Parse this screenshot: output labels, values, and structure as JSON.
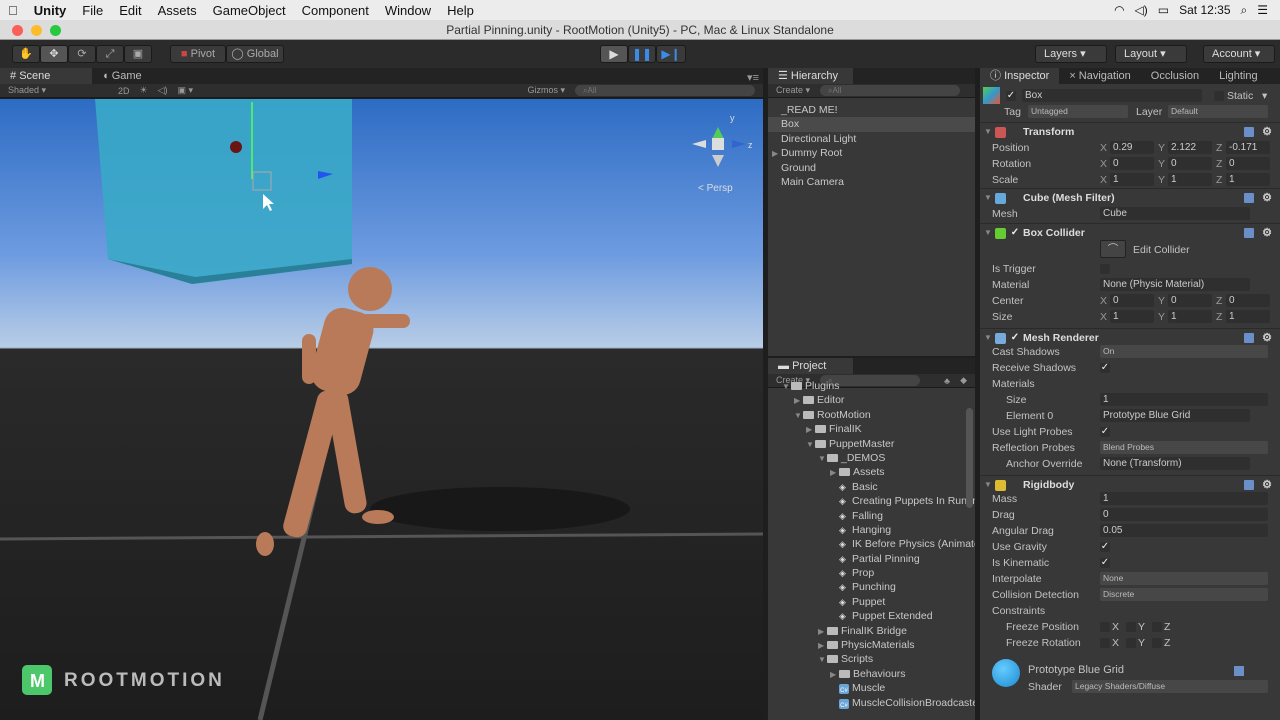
{
  "menubar": {
    "items": [
      "Unity",
      "File",
      "Edit",
      "Assets",
      "GameObject",
      "Component",
      "Window",
      "Help"
    ],
    "clock": "Sat 12:35"
  },
  "window": {
    "title": "Partial Pinning.unity - RootMotion (Unity5) - PC, Mac & Linux Standalone"
  },
  "toolbar": {
    "pivot": "Pivot",
    "global": "Global",
    "layers": "Layers",
    "layout": "Layout",
    "account": "Account"
  },
  "scene": {
    "tab": "Scene",
    "game_tab": "Game",
    "shading": "Shaded",
    "mode2d": "2D",
    "gizmos": "Gizmos",
    "search_placeholder": "All",
    "persp": "Persp",
    "logo": "ROOTMOTION"
  },
  "hierarchy": {
    "tab": "Hierarchy",
    "create": "Create",
    "search_placeholder": "All",
    "items": [
      {
        "label": "_READ ME!",
        "indent": 0,
        "arrow": ""
      },
      {
        "label": "Box",
        "indent": 0,
        "arrow": "",
        "selected": true
      },
      {
        "label": "Directional Light",
        "indent": 0,
        "arrow": ""
      },
      {
        "label": "Dummy Root",
        "indent": 0,
        "arrow": "▶"
      },
      {
        "label": "Ground",
        "indent": 0,
        "arrow": ""
      },
      {
        "label": "Main Camera",
        "indent": 0,
        "arrow": ""
      }
    ]
  },
  "project": {
    "tab": "Project",
    "create": "Create",
    "items": [
      {
        "label": "Plugins",
        "indent": 0,
        "type": "folder",
        "arrow": "▼"
      },
      {
        "label": "Editor",
        "indent": 1,
        "type": "folder",
        "arrow": "▶"
      },
      {
        "label": "RootMotion",
        "indent": 1,
        "type": "folder",
        "arrow": "▼"
      },
      {
        "label": "FinalIK",
        "indent": 2,
        "type": "folder",
        "arrow": "▶"
      },
      {
        "label": "PuppetMaster",
        "indent": 2,
        "type": "folder",
        "arrow": "▼"
      },
      {
        "label": "_DEMOS",
        "indent": 3,
        "type": "folder",
        "arrow": "▼"
      },
      {
        "label": "Assets",
        "indent": 4,
        "type": "folder",
        "arrow": "▶"
      },
      {
        "label": "Basic",
        "indent": 4,
        "type": "scene",
        "arrow": ""
      },
      {
        "label": "Creating Puppets In Runtime",
        "indent": 4,
        "type": "scene",
        "arrow": ""
      },
      {
        "label": "Falling",
        "indent": 4,
        "type": "scene",
        "arrow": ""
      },
      {
        "label": "Hanging",
        "indent": 4,
        "type": "scene",
        "arrow": ""
      },
      {
        "label": "IK Before Physics (Animator)",
        "indent": 4,
        "type": "scene",
        "arrow": ""
      },
      {
        "label": "Partial Pinning",
        "indent": 4,
        "type": "scene",
        "arrow": ""
      },
      {
        "label": "Prop",
        "indent": 4,
        "type": "scene",
        "arrow": ""
      },
      {
        "label": "Punching",
        "indent": 4,
        "type": "scene",
        "arrow": ""
      },
      {
        "label": "Puppet",
        "indent": 4,
        "type": "scene",
        "arrow": ""
      },
      {
        "label": "Puppet Extended",
        "indent": 4,
        "type": "scene",
        "arrow": ""
      },
      {
        "label": "FinalIK Bridge",
        "indent": 3,
        "type": "folder",
        "arrow": "▶"
      },
      {
        "label": "PhysicMaterials",
        "indent": 3,
        "type": "folder",
        "arrow": "▶"
      },
      {
        "label": "Scripts",
        "indent": 3,
        "type": "folder",
        "arrow": "▼"
      },
      {
        "label": "Behaviours",
        "indent": 4,
        "type": "folder",
        "arrow": "▶"
      },
      {
        "label": "Muscle",
        "indent": 4,
        "type": "script",
        "arrow": ""
      },
      {
        "label": "MuscleCollisionBroadcaster",
        "indent": 4,
        "type": "script",
        "arrow": ""
      }
    ]
  },
  "inspector": {
    "tabs": [
      "Inspector",
      "Navigation",
      "Occlusion",
      "Lighting"
    ],
    "object_name": "Box",
    "static": "Static",
    "tag_label": "Tag",
    "tag": "Untagged",
    "layer_label": "Layer",
    "layer": "Default",
    "transform": {
      "title": "Transform",
      "rows": [
        {
          "label": "Position",
          "x": "0.29",
          "y": "2.122",
          "z": "-0.171"
        },
        {
          "label": "Rotation",
          "x": "0",
          "y": "0",
          "z": "0"
        },
        {
          "label": "Scale",
          "x": "1",
          "y": "1",
          "z": "1"
        }
      ]
    },
    "mesh_filter": {
      "title": "Cube (Mesh Filter)",
      "mesh_label": "Mesh",
      "mesh": "Cube"
    },
    "box_collider": {
      "title": "Box Collider",
      "edit": "Edit Collider",
      "is_trigger": "Is Trigger",
      "material_label": "Material",
      "material": "None (Physic Material)",
      "center": {
        "label": "Center",
        "x": "0",
        "y": "0",
        "z": "0"
      },
      "size": {
        "label": "Size",
        "x": "1",
        "y": "1",
        "z": "1"
      }
    },
    "mesh_renderer": {
      "title": "Mesh Renderer",
      "cast_shadows_label": "Cast Shadows",
      "cast_shadows": "On",
      "receive_shadows": "Receive Shadows",
      "materials": "Materials",
      "size_label": "Size",
      "size": "1",
      "element0_label": "Element 0",
      "element0": "Prototype Blue Grid",
      "light_probes": "Use Light Probes",
      "reflection_label": "Reflection Probes",
      "reflection": "Blend Probes",
      "anchor_label": "Anchor Override",
      "anchor": "None (Transform)"
    },
    "rigidbody": {
      "title": "Rigidbody",
      "mass_label": "Mass",
      "mass": "1",
      "drag_label": "Drag",
      "drag": "0",
      "angular_label": "Angular Drag",
      "angular": "0.05",
      "gravity": "Use Gravity",
      "kinematic": "Is Kinematic",
      "interpolate_label": "Interpolate",
      "interpolate": "None",
      "collision_label": "Collision Detection",
      "collision": "Discrete",
      "constraints": "Constraints",
      "freeze_pos": "Freeze Position",
      "freeze_rot": "Freeze Rotation",
      "axes": [
        "X",
        "Y",
        "Z"
      ]
    },
    "material": {
      "name": "Prototype Blue Grid",
      "shader_label": "Shader",
      "shader": "Legacy Shaders/Diffuse"
    }
  },
  "colors": {
    "accent": "#3a8ce8",
    "box": "#3ab0d0"
  }
}
